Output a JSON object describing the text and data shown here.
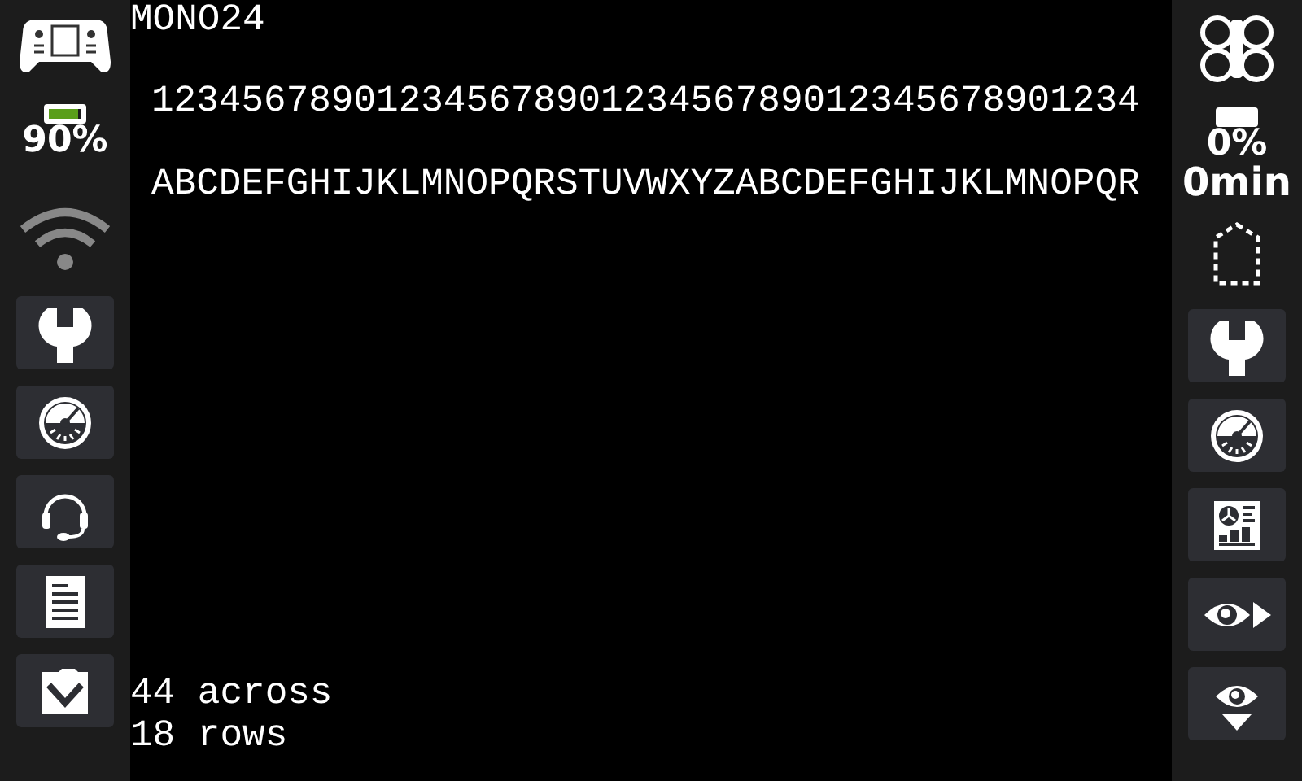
{
  "left_sidebar": {
    "battery": {
      "level": 0.9,
      "reading": "90%"
    },
    "wifi": {
      "connected": false
    },
    "buttons": [
      {
        "kind": "wrench"
      },
      {
        "kind": "gauge"
      },
      {
        "kind": "headset"
      },
      {
        "kind": "document"
      },
      {
        "kind": "folder-down"
      }
    ]
  },
  "main": {
    "title": "MONO24",
    "lines": [
      "12345678901234567890123456789012345678901234",
      "ABCDEFGHIJKLMNOPQRSTUVWXYZABCDEFGHIJKLMNOPQR"
    ],
    "footer": [
      "44 across",
      "18 rows"
    ]
  },
  "right_sidebar": {
    "battery_reading": "0%",
    "time_reading": "0min",
    "buttons": [
      {
        "kind": "wrench"
      },
      {
        "kind": "gauge"
      },
      {
        "kind": "dashboard"
      },
      {
        "kind": "eye-right"
      },
      {
        "kind": "eye-down"
      }
    ]
  }
}
